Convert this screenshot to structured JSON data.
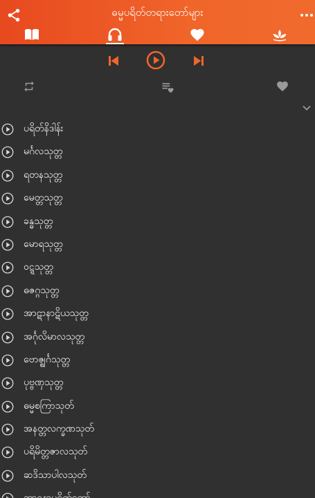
{
  "app_title": "ဓမ္မပရိတ်တရားတော်များ",
  "colors": {
    "accent": "#f0652a",
    "background": "#303030",
    "icon_muted": "#9a9a9a",
    "text": "#ffffff"
  },
  "toolbar": {
    "share_icon": "share-icon",
    "more_icon": "more-vert-icon"
  },
  "tabs": [
    {
      "icon": "book-icon",
      "selected": false
    },
    {
      "icon": "headphones-icon",
      "selected": true
    },
    {
      "icon": "heart-icon",
      "selected": false
    },
    {
      "icon": "lotus-icon",
      "selected": false
    }
  ],
  "player": {
    "prev_icon": "skip-previous-icon",
    "play_icon": "play-circle-icon",
    "next_icon": "skip-next-icon"
  },
  "options": {
    "repeat_icon": "repeat-icon",
    "playlist_icon": "playlist-favorite-icon",
    "favorite_icon": "heart-icon"
  },
  "tracks": [
    {
      "title": "ပရိတ်နိဒါန်း"
    },
    {
      "title": "မင်္ဂလသုတ္တ"
    },
    {
      "title": "ရတနသုတ္တ"
    },
    {
      "title": "မေတ္တသုတ္တ"
    },
    {
      "title": "ခန္ဓသုတ္တ"
    },
    {
      "title": "မောရသုတ္တ"
    },
    {
      "title": "ဝဋ္ဋသုတ္တ"
    },
    {
      "title": "ဓဇဂ္ဂသုတ္တ"
    },
    {
      "title": "အာဋာနာဋိယသုတ္တ"
    },
    {
      "title": "အင်္ဂုလိမာလသုတ္တ"
    },
    {
      "title": "ဗောဇ္ဈင်္ဂသုတ္တ"
    },
    {
      "title": "ပုဗ္ဗဏှသုတ္တ"
    },
    {
      "title": "ဓမ္မစကြာသုတ်"
    },
    {
      "title": "အနတ္တလက္ခဏသုတ်"
    },
    {
      "title": "ပရိမိတ္တဇာလသုတ်"
    },
    {
      "title": "ဆဒိသာပါလသုတ်"
    },
    {
      "title": "ဘာဝနာပရိတ်တော်"
    }
  ]
}
